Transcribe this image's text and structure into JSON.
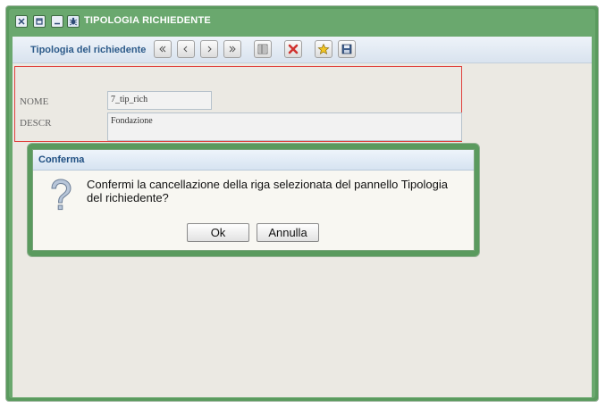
{
  "window": {
    "title": "TIPOLOGIA RICHIEDENTE",
    "controls": [
      "close-icon",
      "maximize-icon",
      "minimize-icon",
      "bug-icon"
    ]
  },
  "toolbar": {
    "title": "Tipologia del richiedente",
    "buttons": [
      "first-record-icon",
      "previous-record-icon",
      "next-record-icon",
      "last-record-icon",
      "list-view-icon",
      "delete-icon",
      "favorite-icon",
      "save-icon"
    ]
  },
  "form": {
    "nome_label": "NOME",
    "nome_value": "7_tip_rich",
    "descr_label": "DESCR",
    "descr_value": "Fondazione"
  },
  "dialog": {
    "title": "Conferma",
    "message": "Confermi la cancellazione della riga selezionata del pannello Tipologia del richiedente?",
    "ok_label": "Ok",
    "cancel_label": "Annulla",
    "icon": "question-icon"
  },
  "colors": {
    "frame_green": "#5a9a5e",
    "title_blue": "#1f4f82",
    "selection_red": "#e0413d"
  }
}
